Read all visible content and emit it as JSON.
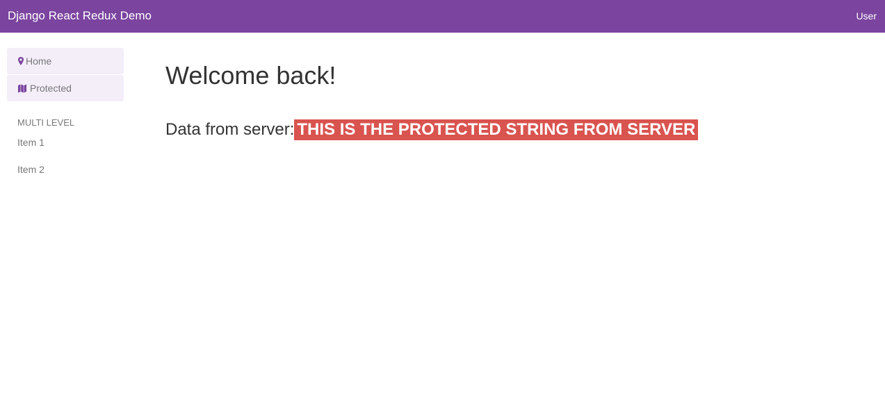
{
  "navbar": {
    "brand": "Django React Redux Demo",
    "user": "User"
  },
  "sidebar": {
    "items": [
      {
        "label": "Home",
        "icon": "map-marker-icon"
      },
      {
        "label": "Protected",
        "icon": "map-icon"
      }
    ],
    "section_header": "MULTI LEVEL",
    "sub_items": [
      {
        "label": "Item 1"
      },
      {
        "label": "Item 2"
      }
    ]
  },
  "main": {
    "title": "Welcome back!",
    "data_label": "Data from server:",
    "data_value": "THIS IS THE PROTECTED STRING FROM SERVER"
  },
  "colors": {
    "navbar": "#7a449f",
    "sidebar_item_bg": "#f4eef9",
    "icon_accent": "#7a449f",
    "badge": "#d9534f"
  }
}
